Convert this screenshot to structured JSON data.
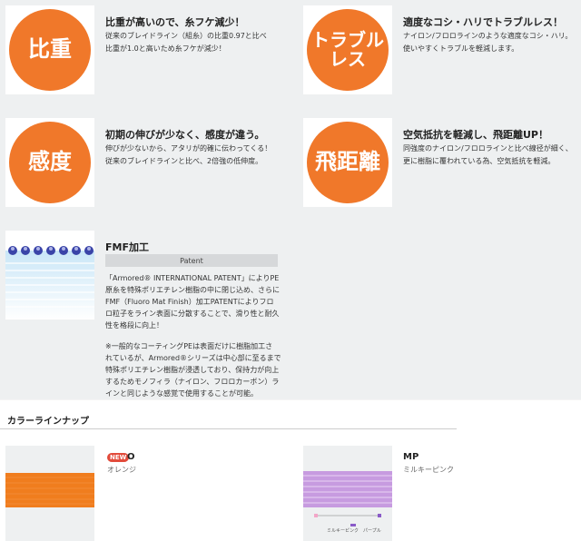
{
  "features": [
    {
      "icon_text": "比重",
      "title": "比重が高いので、糸フケ減少！",
      "desc": "従来のブレイドライン（組糸）の比重0.97と比べ\n比重が1.0と高いため糸フケが減少！"
    },
    {
      "icon_text": "トラブル\nレス",
      "title": "適度なコシ・ハリでトラブルレス！",
      "desc": "ナイロン/フロロラインのような適度なコシ・ハリ。\n使いやすくトラブルを軽減します。"
    },
    {
      "icon_text": "感度",
      "title": "初期の伸びが少なく、感度が違う。",
      "desc": "伸びが少ないから、アタリが的確に伝わってくる！\n従来のブレイドラインと比べ、2倍強の低伸度。"
    },
    {
      "icon_text": "飛距離",
      "title": "空気抵抗を軽減し、飛距離UP！",
      "desc": "同強度のナイロン/フロロラインと比べ線径が細く、\n更に樹脂に覆われている為、空気抵抗を軽減。"
    }
  ],
  "fmf": {
    "title": "FMF加工",
    "patent_label": "Patent",
    "para1": "「Armored® INTERNATIONAL PATENT」によりPE\n原糸を特殊ポリエチレン樹脂の中に閉じ込め、さらに\nFMF（Fluoro Mat Finish）加工PATENTによりフロ\nロ粒子をライン表面に分散することで、滑り性と耐久\n性を格段に向上！",
    "para2": "※一般的なコーティングPEは表面だけに樹脂加工さ\nれているが、Armored®シリーズは中心部に至るまで\n特殊ポリエチレン樹脂が浸透しており、保持力が向上\nするためモノフィラ（ナイロン、フロロカーボン）ラ\nインと同じような感覚で使用することが可能。"
  },
  "color_lineup": {
    "section_title": "カラーラインナップ",
    "items": [
      {
        "badge": "NEW",
        "code": "O",
        "name": "オレンジ",
        "color": "#f07d1e"
      },
      {
        "badge": "",
        "code": "MP",
        "name": "ミルキーピンク",
        "color": "#b98ad6",
        "swatch_label": "ミルキーピンク　パープル"
      }
    ]
  },
  "colors": {
    "accent_orange": "#f0782a",
    "panel_bg": "#eef0f1",
    "fmf_blue": "#3a44a8"
  }
}
